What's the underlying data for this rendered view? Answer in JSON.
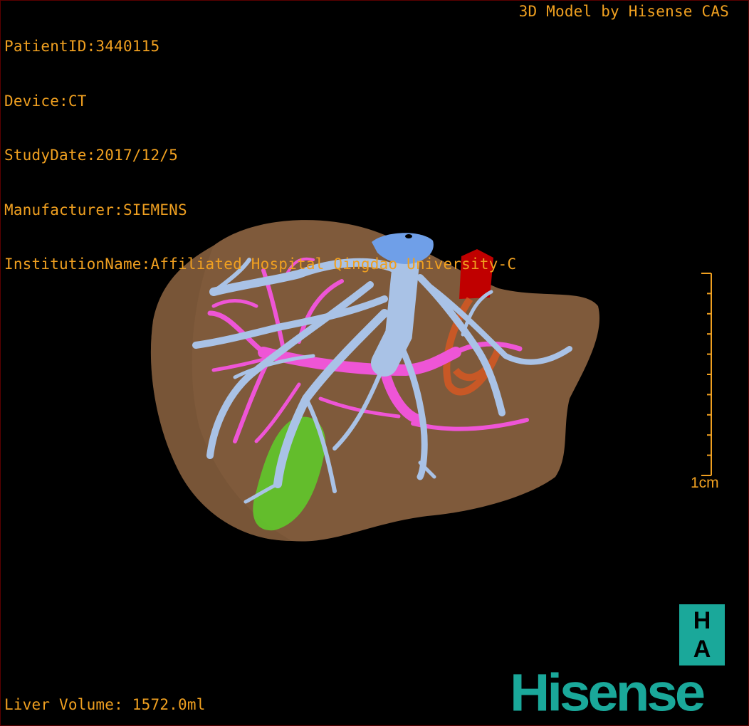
{
  "header": {
    "patient_id": "PatientID:3440115",
    "device": "Device:CT",
    "study_date": "StudyDate:2017/12/5",
    "manufacturer": "Manufacturer:SIEMENS",
    "institution": "InstitutionName:Affiliated Hospital Qingdao University-C"
  },
  "credit": "3D Model by Hisense CAS",
  "scale_bar": {
    "label": "1cm",
    "ticks": 10,
    "color": "#f0a020"
  },
  "volume": "Liver Volume: 1572.0ml",
  "logo": {
    "top_letter": "H",
    "bottom_letter": "A",
    "brand": "Hisense",
    "color": "#1aa89a"
  },
  "model": {
    "structures": [
      {
        "name": "liver",
        "color": "#8a6240"
      },
      {
        "name": "hepatic-veins",
        "color": "#a9c2e6"
      },
      {
        "name": "inferior-vena-cava-top",
        "color": "#6f9fe8"
      },
      {
        "name": "portal-vein",
        "color": "#ee55d6"
      },
      {
        "name": "aorta",
        "color": "#c00000"
      },
      {
        "name": "hepatic-artery",
        "color": "#e05820"
      },
      {
        "name": "gallbladder",
        "color": "#5ecf2a"
      }
    ]
  }
}
